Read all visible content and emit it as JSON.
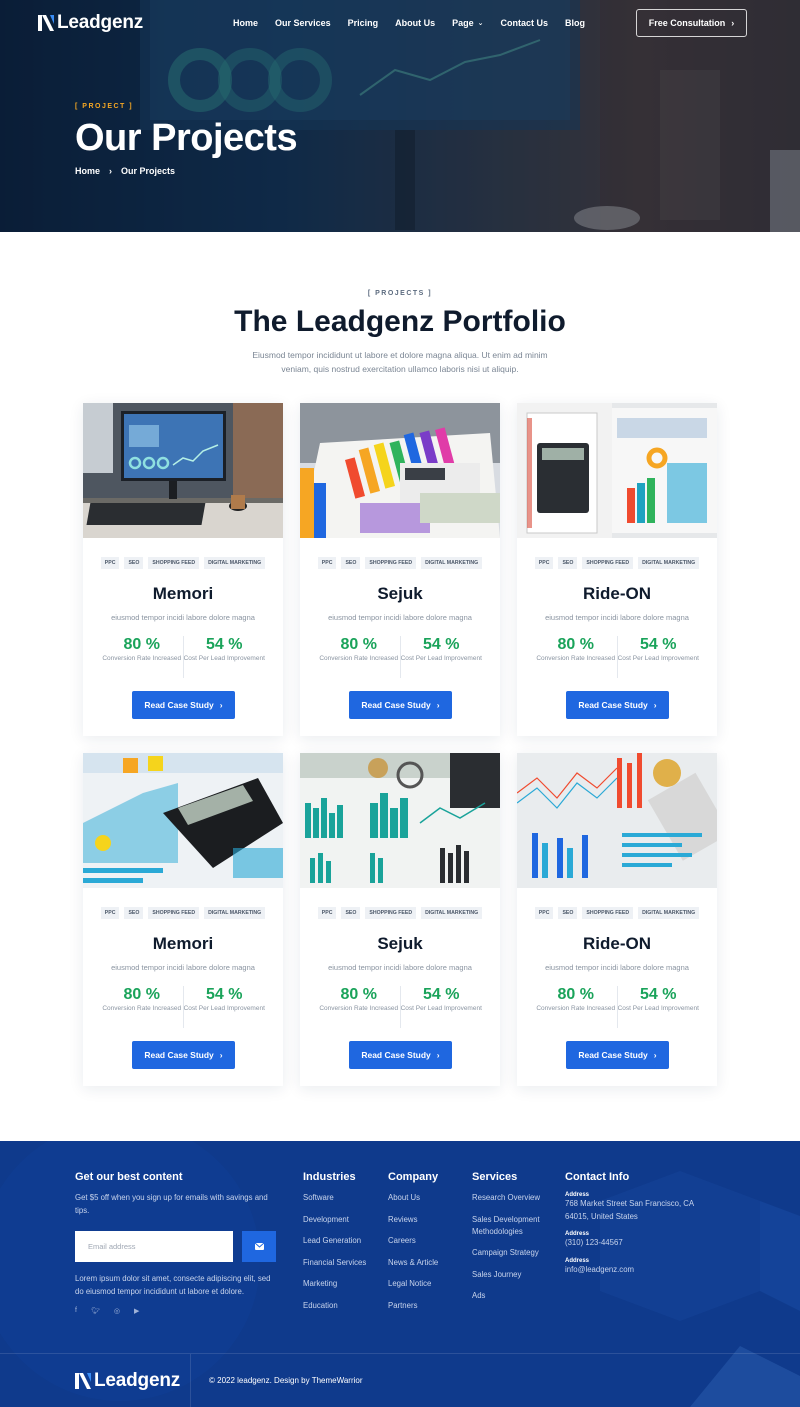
{
  "brand": {
    "name": "Leadgenz"
  },
  "nav": {
    "links": [
      "Home",
      "Our Services",
      "Pricing",
      "About Us",
      "Page",
      "Contact Us",
      "Blog"
    ],
    "cta": "Free Consultation"
  },
  "hero": {
    "tag": "[ PROJECT ]",
    "title": "Our Projects",
    "breadcrumb": [
      "Home",
      "Our Projects"
    ]
  },
  "portfolio": {
    "tag": "[ PROJECTS ]",
    "title": "The Leadgenz Portfolio",
    "description": "Eiusmod tempor incididunt ut labore et dolore magna aliqua. Ut enim ad minim veniam, quis nostrud exercitation ullamco laboris nisi ut aliquip.",
    "cards": [
      {
        "tags": [
          "PPC",
          "SEO",
          "SHOPPING FEED",
          "DIGITAL MARKETING"
        ],
        "title": "Memori",
        "subtitle": "eiusmod tempor incidi labore dolore magna",
        "stat1_value": "80 %",
        "stat1_label": "Conversion Rate Increased",
        "stat2_value": "54 %",
        "stat2_label": "Cost Per Lead Improvement",
        "button": "Read Case Study"
      },
      {
        "tags": [
          "PPC",
          "SEO",
          "SHOPPING FEED",
          "DIGITAL MARKETING"
        ],
        "title": "Sejuk",
        "subtitle": "eiusmod tempor incidi labore dolore magna",
        "stat1_value": "80 %",
        "stat1_label": "Conversion Rate Increased",
        "stat2_value": "54 %",
        "stat2_label": "Cost Per Lead Improvement",
        "button": "Read Case Study"
      },
      {
        "tags": [
          "PPC",
          "SEO",
          "SHOPPING FEED",
          "DIGITAL MARKETING"
        ],
        "title": "Ride-ON",
        "subtitle": "eiusmod tempor incidi labore dolore magna",
        "stat1_value": "80 %",
        "stat1_label": "Conversion Rate Increased",
        "stat2_value": "54 %",
        "stat2_label": "Cost Per Lead Improvement",
        "button": "Read Case Study"
      },
      {
        "tags": [
          "PPC",
          "SEO",
          "SHOPPING FEED",
          "DIGITAL MARKETING"
        ],
        "title": "Memori",
        "subtitle": "eiusmod tempor incidi labore dolore magna",
        "stat1_value": "80 %",
        "stat1_label": "Conversion Rate Increased",
        "stat2_value": "54 %",
        "stat2_label": "Cost Per Lead Improvement",
        "button": "Read Case Study"
      },
      {
        "tags": [
          "PPC",
          "SEO",
          "SHOPPING FEED",
          "DIGITAL MARKETING"
        ],
        "title": "Sejuk",
        "subtitle": "eiusmod tempor incidi labore dolore magna",
        "stat1_value": "80 %",
        "stat1_label": "Conversion Rate Increased",
        "stat2_value": "54 %",
        "stat2_label": "Cost Per Lead Improvement",
        "button": "Read Case Study"
      },
      {
        "tags": [
          "PPC",
          "SEO",
          "SHOPPING FEED",
          "DIGITAL MARKETING"
        ],
        "title": "Ride-ON",
        "subtitle": "eiusmod tempor incidi labore dolore magna",
        "stat1_value": "80 %",
        "stat1_label": "Conversion Rate Increased",
        "stat2_value": "54 %",
        "stat2_label": "Cost Per Lead Improvement",
        "button": "Read Case Study"
      }
    ]
  },
  "footer": {
    "newsletter": {
      "title": "Get our best content",
      "text": "Get $5 off when you sign up for emails with savings and tips.",
      "placeholder": "Email address",
      "about": "Lorem ipsum dolor sit amet, consecte adipiscing elit, sed do eiusmod tempor incididunt ut labore et dolore."
    },
    "industries": {
      "title": "Industries",
      "links": [
        "Software",
        "Development",
        "Lead Generation",
        "Financial Services",
        "Marketing",
        "Education"
      ]
    },
    "company": {
      "title": "Company",
      "links": [
        "About Us",
        "Reviews",
        "Careers",
        "News & Article",
        "Legal Notice",
        "Partners"
      ]
    },
    "services": {
      "title": "Services",
      "links": [
        "Research Overview",
        "Sales Development Methodologies",
        "Campaign Strategy",
        "Sales Journey",
        "Ads"
      ]
    },
    "contact": {
      "title": "Contact Info",
      "items": [
        {
          "label": "Address",
          "value": "768 Market Street San Francisco, CA 64015, United States"
        },
        {
          "label": "Address",
          "value": "(310) 123-44567"
        },
        {
          "label": "Address",
          "value": "info@leadgenz.com"
        }
      ]
    },
    "copyright": "© 2022 leadgenz. Design by ThemeWarrior"
  },
  "colors": {
    "primary": "#1f67e0",
    "accent": "#f5a623",
    "success": "#1aa35a",
    "footer": "#0f3a8c",
    "heading": "#0f1b2d"
  }
}
